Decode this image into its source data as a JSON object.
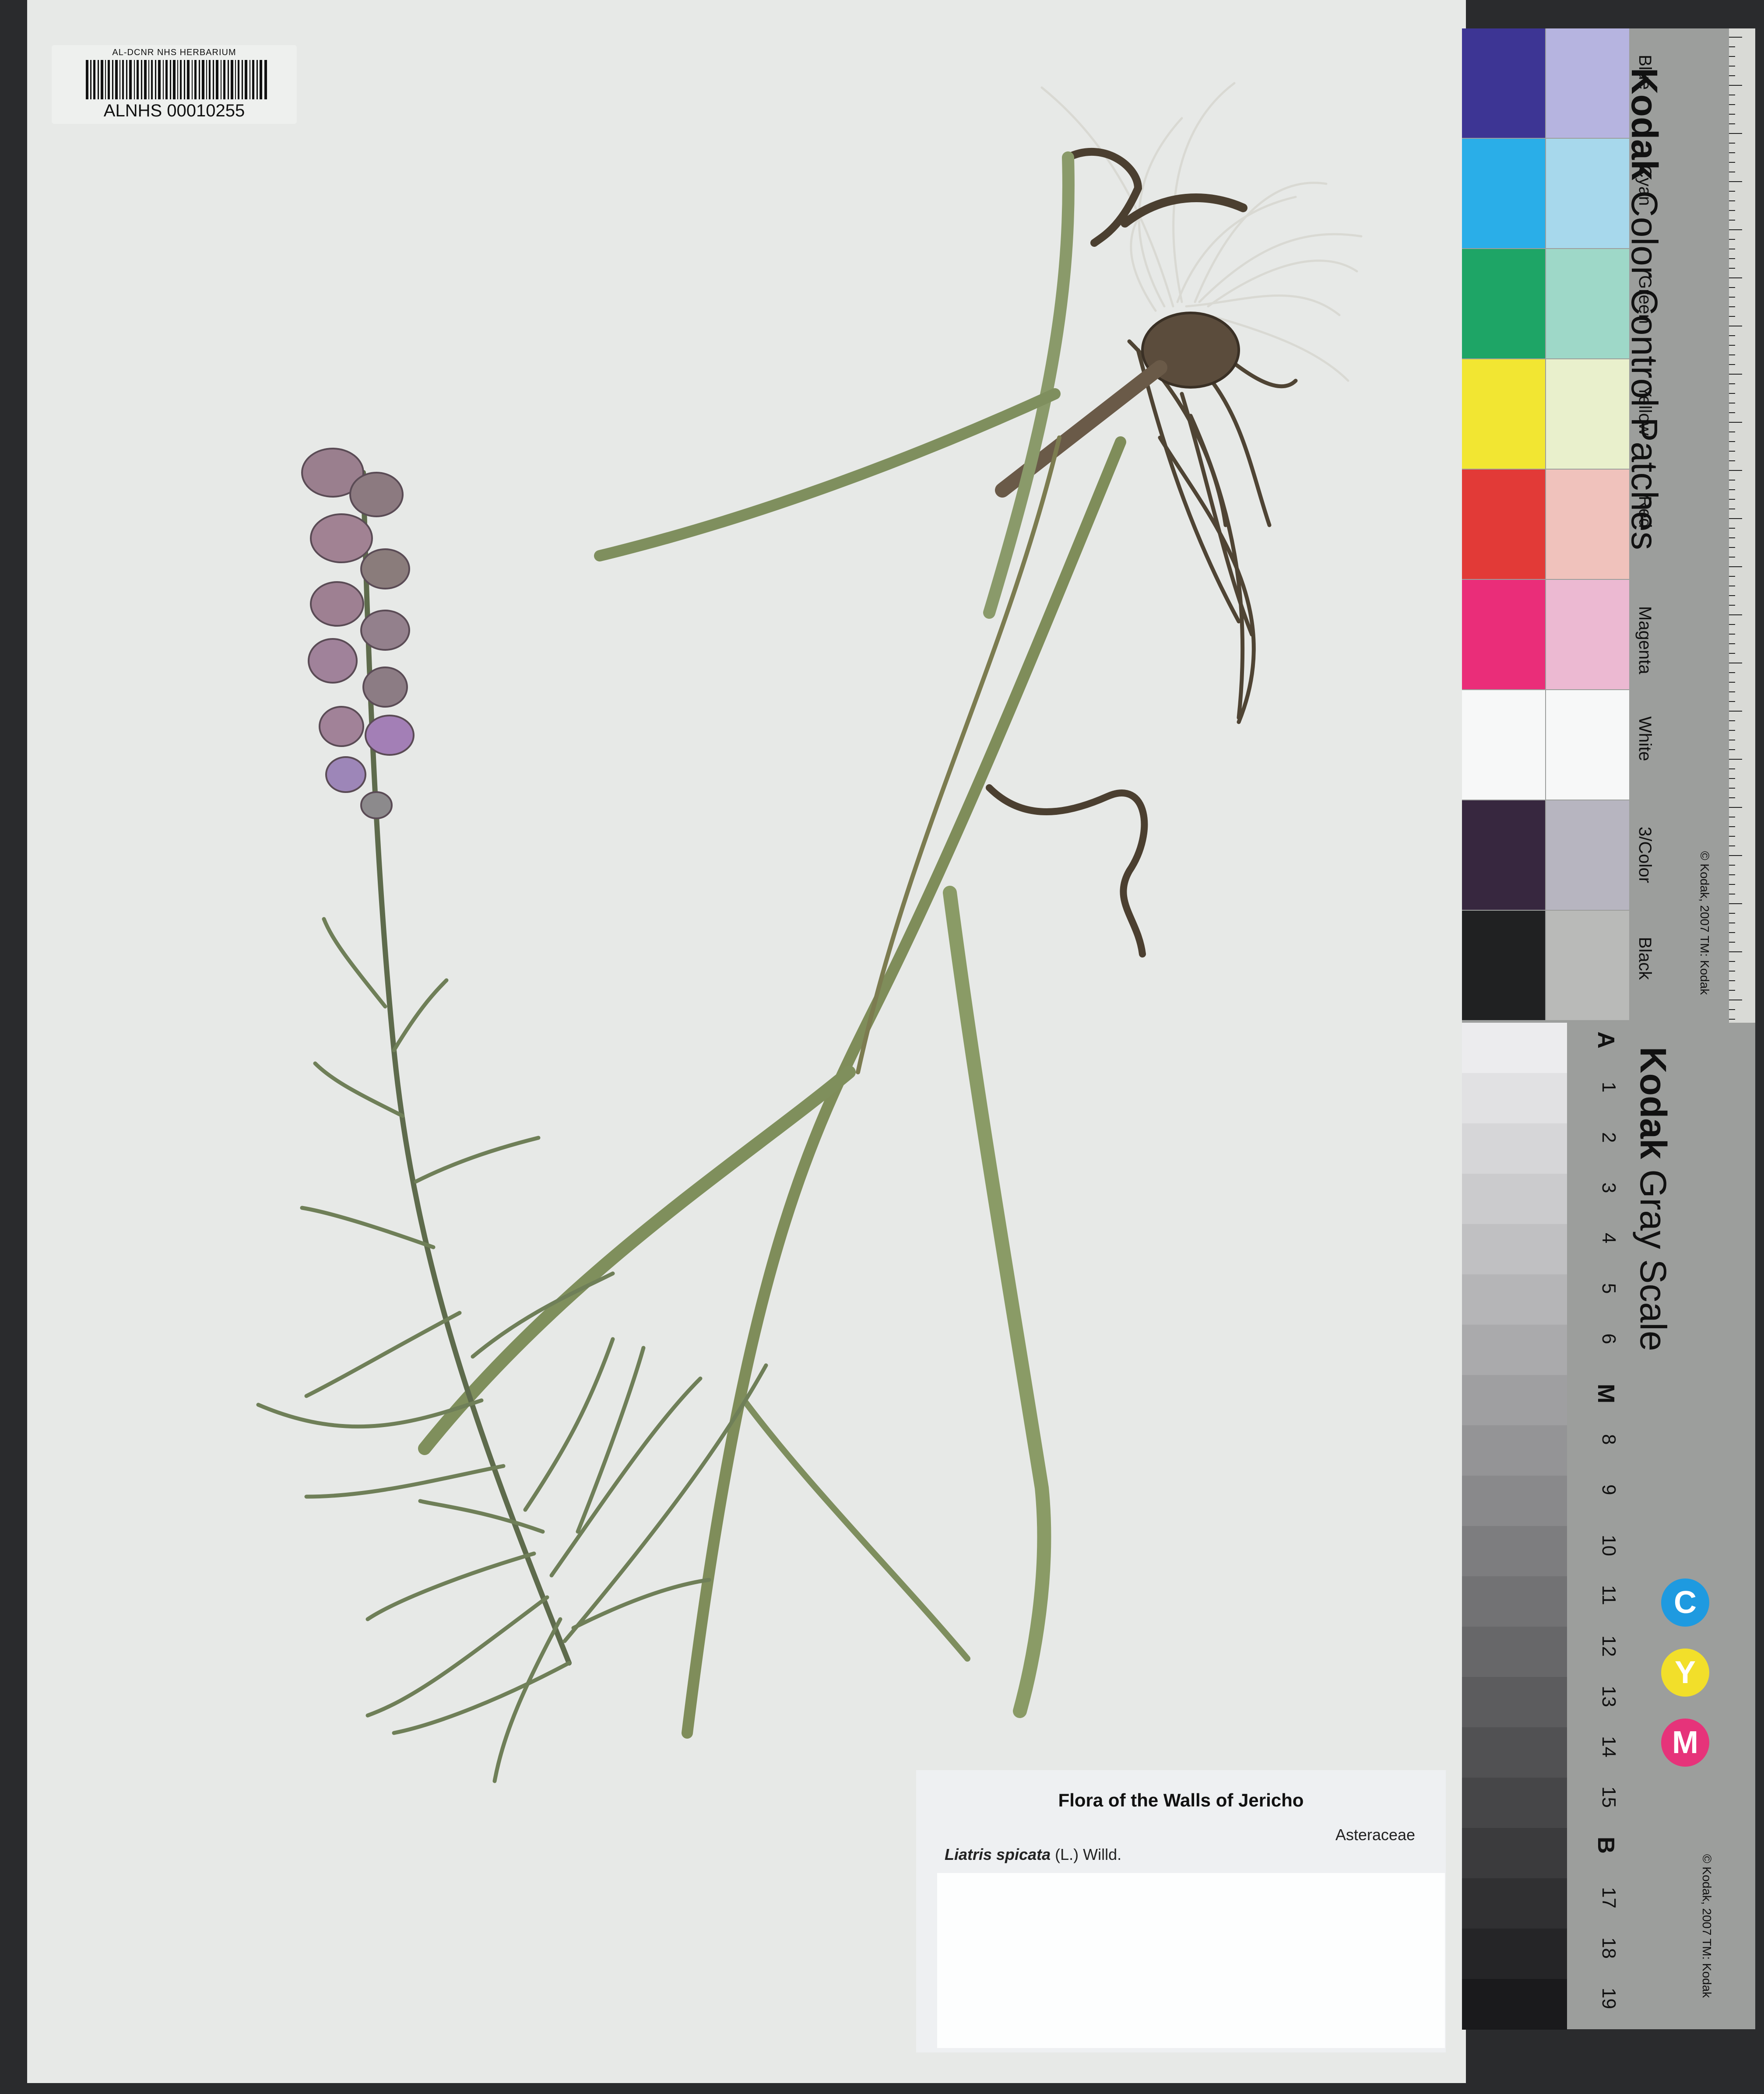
{
  "herbarium_barcode": {
    "institution": "AL-DCNR NHS HERBARIUM",
    "number": "ALNHS 00010255"
  },
  "label": {
    "title": "Flora of  the Walls of Jericho",
    "family": "Asteraceae",
    "species": "Liatris spicata",
    "authority": "(L.) Willd."
  },
  "color_card": {
    "brand": "Kodak",
    "title": "Color Control Patches",
    "patches": [
      {
        "name": "Blue",
        "dark": "#3d3594",
        "light": "#b6b4e0"
      },
      {
        "name": "Cyan",
        "dark": "#2aaee8",
        "light": "#a7d8ec"
      },
      {
        "name": "Green",
        "dark": "#1ea566",
        "light": "#9ed8c8"
      },
      {
        "name": "Yellow",
        "dark": "#f2e632",
        "light": "#e9f0cc"
      },
      {
        "name": "Red",
        "dark": "#e23a37",
        "light": "#f0c2bc"
      },
      {
        "name": "Magenta",
        "dark": "#ea2d79",
        "light": "#ecb9d2"
      },
      {
        "name": "White",
        "dark": "#f7f8f8",
        "light": "#f7f8f8"
      },
      {
        "name": "3/Color",
        "dark": "#37273f",
        "light": "#b7b5c0"
      },
      {
        "name": "Black",
        "dark": "#202122",
        "light": "#b9bab8"
      }
    ],
    "copyright": "© Kodak, 2007 TM: Kodak",
    "ruler_units": [
      "cm",
      "inches"
    ]
  },
  "gray_card": {
    "brand": "Kodak",
    "title": "Gray Scale",
    "steps": [
      "A",
      "1",
      "2",
      "3",
      "4",
      "5",
      "6",
      "M",
      "8",
      "9",
      "10",
      "11",
      "12",
      "13",
      "14",
      "15",
      "B",
      "17",
      "18",
      "19"
    ],
    "cmy": [
      {
        "letter": "C",
        "color": "#1e9ae0"
      },
      {
        "letter": "Y",
        "color": "#f2df2a"
      },
      {
        "letter": "M",
        "color": "#e6337a"
      }
    ],
    "copyright": "© Kodak, 2007 TM: Kodak"
  }
}
